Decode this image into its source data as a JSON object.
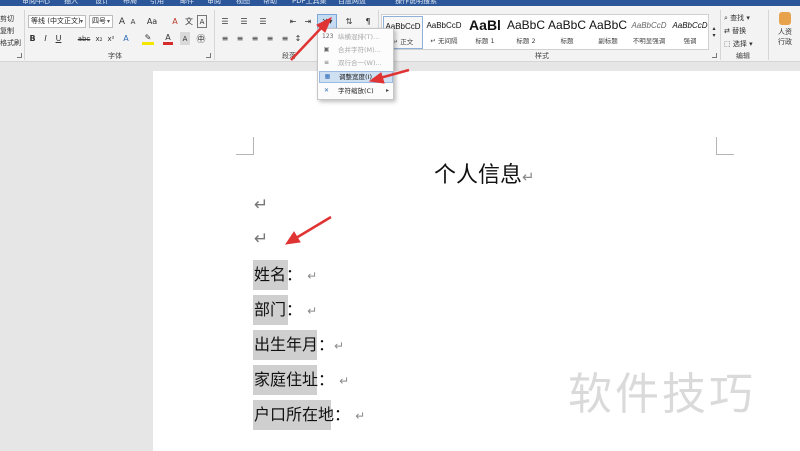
{
  "tabs": [
    "审阅中心",
    "插入",
    "设计",
    "布局",
    "引用",
    "邮件",
    "审阅",
    "视图",
    "帮助",
    "PDF工具集",
    "百度网盘",
    "操作说明搜索"
  ],
  "clipboard": {
    "cut": "剪切",
    "copy": "复制",
    "format_painter": "格式刷"
  },
  "font": {
    "group_label": "字体",
    "font_name": "等线 (中文正文)",
    "font_size": "四号",
    "grow": "A",
    "shrink": "A",
    "case": "Aa",
    "bold": "B",
    "italic": "I",
    "underline": "U",
    "strike": "abc",
    "subscript": "x₂",
    "superscript": "x²"
  },
  "paragraph": {
    "group_label": "段落"
  },
  "styles": {
    "group_label": "样式",
    "items": [
      {
        "sample": "AaBbCcD",
        "name": "↵ 正文"
      },
      {
        "sample": "AaBbCcD",
        "name": "↵ 无间隔"
      },
      {
        "sample": "AaBl",
        "name": "标题 1"
      },
      {
        "sample": "AaBbC",
        "name": "标题 2"
      },
      {
        "sample": "AaBbC",
        "name": "标题"
      },
      {
        "sample": "AaBbC",
        "name": "副标题"
      },
      {
        "sample": "AaBbCcD",
        "name": "不明显强调"
      },
      {
        "sample": "AaBbCcD",
        "name": "强调"
      }
    ]
  },
  "editing": {
    "group_label": "编辑",
    "find": "查找",
    "replace": "替换",
    "select": "选择"
  },
  "extra": {
    "label_line1": "人资",
    "label_line2": "行政"
  },
  "menu": {
    "items": [
      {
        "icon": "123",
        "label": "纵横混排(T)..."
      },
      {
        "icon": "▣",
        "label": "合并字符(M)..."
      },
      {
        "icon": "≡",
        "label": "双行合一(W)..."
      },
      {
        "icon": "▦",
        "label": "调整宽度(I)..."
      },
      {
        "icon": "✕",
        "label": "字符缩放(C)"
      }
    ]
  },
  "document": {
    "title": "个人信息",
    "return_mark": "↵",
    "fields": [
      {
        "label": "姓名："
      },
      {
        "label": "部门："
      },
      {
        "label": "出生年月："
      },
      {
        "label": "家庭住址："
      },
      {
        "label": "户口所在地："
      }
    ]
  },
  "watermark": "软件技巧",
  "colors": {
    "tab_bar": "#2b579a",
    "ribbon_bg": "#f3f3f3",
    "highlight": "#cfcfcf",
    "arrow": "#e03434",
    "menu_hover": "#cfe0f3"
  }
}
